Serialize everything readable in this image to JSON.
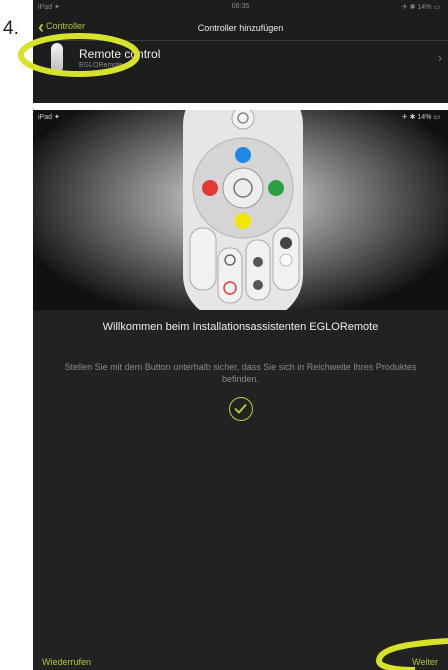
{
  "step_number": "4.",
  "screen1": {
    "status_bar": {
      "left": "iPad ✦",
      "time": "08:35",
      "right": "✈ ✱ 14% ▭"
    },
    "nav": {
      "back_label": "Controller",
      "title": "Controller hinzufügen"
    },
    "list_item": {
      "title": "Remote control",
      "subtitle": "EGLORemote"
    },
    "highlight_color": "#d7e22b"
  },
  "screen2": {
    "status_bar": {
      "left": "iPad ✦",
      "right": "✈ ✱ 14% ▭"
    },
    "remote_colors": {
      "blue": "#1e88e5",
      "red": "#e53935",
      "green": "#2e9e43",
      "yellow": "#f2e500"
    },
    "welcome_text": "Willkommen beim Installationsassistenten EGLORemote",
    "instruction_text": "Stellen Sie mit dem Button unterhalb sicher, dass Sie sich in Reichweite Ihres Produktes befinden.",
    "back_button": "Wiederrufen",
    "next_button": "Weiter",
    "accent_color": "#b5c33a"
  }
}
